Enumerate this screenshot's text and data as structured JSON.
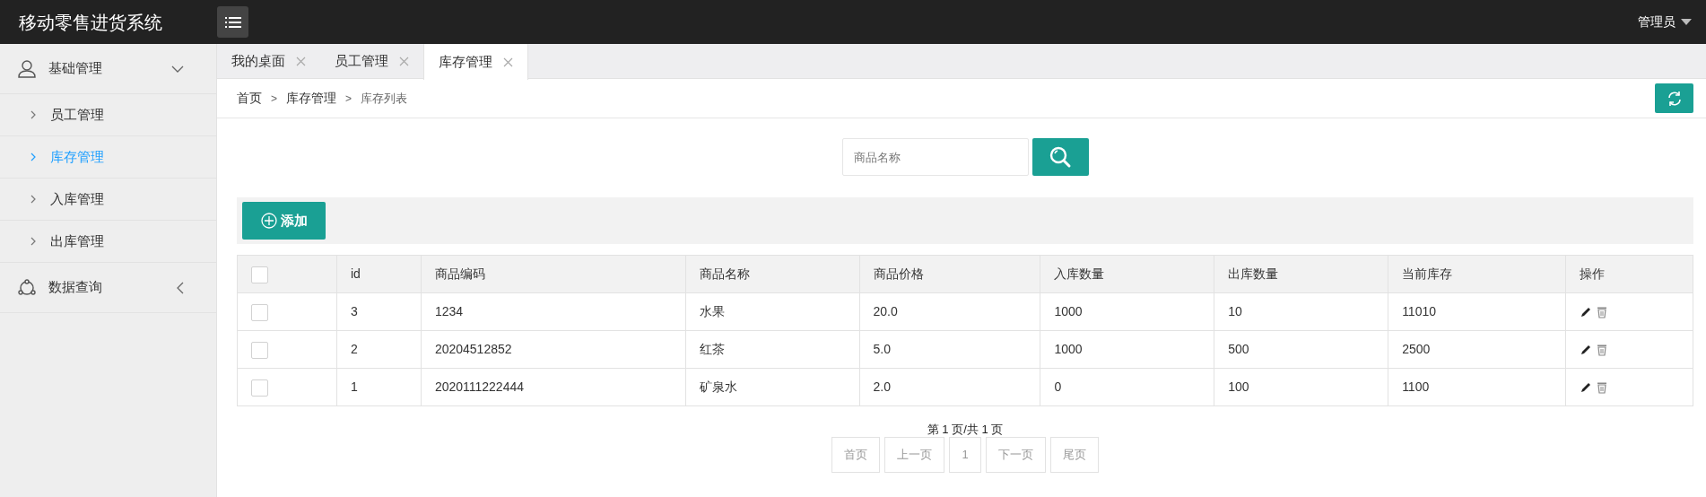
{
  "header": {
    "title": "移动零售进货系统",
    "user": "管理员"
  },
  "sidebar": {
    "groups": [
      {
        "label": "基础管理",
        "expanded": true,
        "children": [
          {
            "label": "员工管理",
            "selected": false
          },
          {
            "label": "库存管理",
            "selected": true
          },
          {
            "label": "入库管理",
            "selected": false
          },
          {
            "label": "出库管理",
            "selected": false
          }
        ]
      },
      {
        "label": "数据查询",
        "expanded": false
      }
    ]
  },
  "tabs": [
    {
      "label": "我的桌面",
      "selected": false
    },
    {
      "label": "员工管理",
      "selected": false
    },
    {
      "label": "库存管理",
      "selected": true
    }
  ],
  "breadcrumb": {
    "separator": ">",
    "items": [
      "首页",
      "库存管理",
      "库存列表"
    ]
  },
  "search": {
    "placeholder": "商品名称"
  },
  "add_button": "添加",
  "table": {
    "select_all_checked": false,
    "columns": [
      "id",
      "商品编码",
      "商品名称",
      "商品价格",
      "入库数量",
      "出库数量",
      "当前库存",
      "操作"
    ],
    "rows": [
      {
        "checked": false,
        "cells": [
          "3",
          "1234",
          "水果",
          "20.0",
          "1000",
          "10",
          "11010"
        ]
      },
      {
        "checked": false,
        "cells": [
          "2",
          "20204512852",
          "红茶",
          "5.0",
          "1000",
          "500",
          "2500"
        ]
      },
      {
        "checked": false,
        "cells": [
          "1",
          "2020111222444",
          "矿泉水",
          "2.0",
          "0",
          "100",
          "1100"
        ]
      }
    ]
  },
  "pagination": {
    "info": "第 1 页/共 1 页",
    "buttons": [
      {
        "label": "首页",
        "selected": false
      },
      {
        "label": "上一页",
        "selected": false
      },
      {
        "label": "1",
        "selected": false
      },
      {
        "label": "下一页",
        "selected": false
      },
      {
        "label": "尾页",
        "selected": false
      }
    ]
  }
}
